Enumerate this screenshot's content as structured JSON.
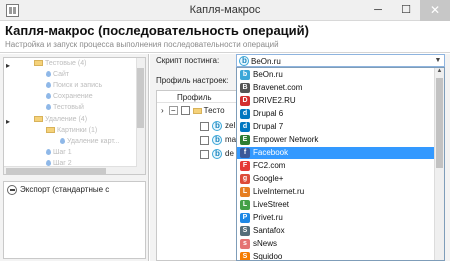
{
  "window": {
    "title": "Капля-макрос",
    "minimize_glyph": "─",
    "maximize_glyph": "☐",
    "close_glyph": "✕"
  },
  "header": {
    "title": "Капля-макрос (последовательность операций)",
    "subtitle": "Настройка и запуск процесса выполнения последовательности операций"
  },
  "left_tree": {
    "items": [
      {
        "label": "Тестовые (4)",
        "icon": "folder-icon",
        "level": 0,
        "expander": "▸"
      },
      {
        "label": "Сайт",
        "icon": "drop-icon",
        "level": 1
      },
      {
        "label": "Поиск и запись",
        "icon": "drop-icon",
        "level": 1
      },
      {
        "label": "Сохранение",
        "icon": "drop-icon",
        "level": 1
      },
      {
        "label": "Тестовый",
        "icon": "drop-icon",
        "level": 1
      },
      {
        "label": "Удаление (4)",
        "icon": "folder-icon",
        "level": 0,
        "expander": "▸"
      },
      {
        "label": "Картинки (1)",
        "icon": "folder-icon",
        "level": 1
      },
      {
        "label": "Удаление карт...",
        "icon": "drop-icon",
        "level": 2
      },
      {
        "label": "Шаг 1",
        "icon": "drop-icon",
        "level": 1
      },
      {
        "label": "Шаг 2",
        "icon": "drop-icon",
        "level": 1
      }
    ],
    "export_label": "Экспорт (стандартные с"
  },
  "form": {
    "script_label": "Скрипт постинга:",
    "script_value": "BeOn.ru",
    "profile_label": "Профиль настроек:",
    "profile_column": "Профиль",
    "profile_rows": [
      {
        "label": "Тесто",
        "type": "folder"
      },
      {
        "label": "zel",
        "type": "beon"
      },
      {
        "label": "ma",
        "type": "beon"
      },
      {
        "label": "de",
        "type": "beon"
      }
    ]
  },
  "dropdown": {
    "items": [
      {
        "label": "BeOn.ru",
        "icon": "beon-icon",
        "color": "#3ba7d8"
      },
      {
        "label": "Bravenet.com",
        "icon": "bravenet-icon",
        "color": "#555555"
      },
      {
        "label": "DRIVE2.RU",
        "icon": "drive2-icon",
        "color": "#d32f2f"
      },
      {
        "label": "Drupal 6",
        "icon": "drupal-icon",
        "color": "#0077c0"
      },
      {
        "label": "Drupal 7",
        "icon": "drupal-icon",
        "color": "#0077c0"
      },
      {
        "label": "Empower Network",
        "icon": "empower-icon",
        "color": "#2e7d32"
      },
      {
        "label": "Facebook",
        "icon": "facebook-icon",
        "color": "#3b5998"
      },
      {
        "label": "FC2.com",
        "icon": "fc2-icon",
        "color": "#e53935"
      },
      {
        "label": "Google+",
        "icon": "google-plus-icon",
        "color": "#dd4b39"
      },
      {
        "label": "LiveInternet.ru",
        "icon": "liveinternet-icon",
        "color": "#e67e22"
      },
      {
        "label": "LiveStreet",
        "icon": "livestreet-icon",
        "color": "#43a047"
      },
      {
        "label": "Privet.ru",
        "icon": "privet-icon",
        "color": "#1e88e5"
      },
      {
        "label": "Santafox",
        "icon": "santafox-icon",
        "color": "#546e7a"
      },
      {
        "label": "sNews",
        "icon": "snews-icon",
        "color": "#e57373"
      },
      {
        "label": "Squidoo",
        "icon": "squidoo-icon",
        "color": "#f57c00"
      }
    ],
    "selected_label": "Facebook",
    "selected_color": "#3399ff"
  }
}
